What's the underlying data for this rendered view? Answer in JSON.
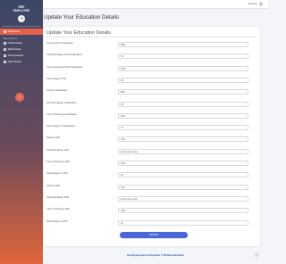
{
  "sidebar": {
    "brand_line1": "ERE",
    "brand_line2": "EMPLOYEE",
    "dashboard_label": "Dashboard",
    "nav_title": "NAVIGATION",
    "items": [
      {
        "label": "Profile Details"
      },
      {
        "label": "Skills Details"
      },
      {
        "label": "Job Experience"
      },
      {
        "label": "Other Details"
      }
    ],
    "toggle_icon": "chevron-left-icon"
  },
  "topbar": {
    "user_name": "Ramshad"
  },
  "page": {
    "title": "Update Your Education Details"
  },
  "card": {
    "title": "Update Your Education Details"
  },
  "fields": [
    {
      "label": "Course Post Graduation",
      "value": "MBA"
    },
    {
      "label": "School/College Post Graduation",
      "value": "NIT"
    },
    {
      "label": "Year of Passing Post Graduation",
      "value": "2015"
    },
    {
      "label": "Percentage of PG",
      "value": "80"
    },
    {
      "label": "Course Graduation",
      "value": "BBA"
    },
    {
      "label": "School/College Graduation",
      "value": "NIT"
    },
    {
      "label": "Year of Passing Graduation",
      "value": "2013"
    },
    {
      "label": "Percentage of Graduation",
      "value": "78"
    },
    {
      "label": "Stream 12th",
      "value": "CSE"
    },
    {
      "label": "School/College 12th",
      "value": "lorem ipsum dolor"
    },
    {
      "label": "Year of Passing 12th",
      "value": "2010"
    },
    {
      "label": "Percentage in 12th",
      "value": "80"
    },
    {
      "label": "Course 10th",
      "value": "SSC"
    },
    {
      "label": "School/College 10th",
      "value": "lorem ipsum dolor"
    },
    {
      "label": "Year of Passing 10th",
      "value": "2008"
    },
    {
      "label": "Percentage in 10th",
      "value": "80"
    }
  ],
  "actions": {
    "update_label": "UPDATE"
  },
  "footer": {
    "text": "Employee Record System © ReflexionDrawn"
  },
  "scroll_top_icon": "chevron-up-icon"
}
